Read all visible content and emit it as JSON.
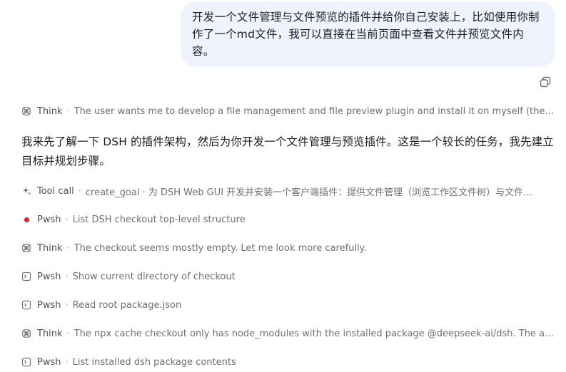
{
  "user_message": {
    "text": "开发一个文件管理与文件预览的插件并给你自己安装上，比如使用你制作了一个md文件，我可以直接在当前页面中查看文件并预览文件内容。"
  },
  "copy_icon": "copy-icon",
  "assistant_message": {
    "text": "我来先了解一下 DSH 的插件架构，然后为你开发一个文件管理与预览插件。这是一个较长的任务，我先建立目标并规划步骤。"
  },
  "steps": [
    {
      "kind": "Think",
      "icon": "brain-icon",
      "desc": "The user wants me to develop a file management and file preview plugin and install it on myself (the DSH h…"
    },
    {
      "kind": "Tool call",
      "icon": "sparkle-icon",
      "desc": "create_goal · 为 DSH Web GUI 开发并安装一个客户端插件：提供文件管理（浏览工作区文件树）与文件…"
    },
    {
      "kind": "Pwsh",
      "icon": "running-dot-icon",
      "desc": "List DSH checkout top-level structure"
    },
    {
      "kind": "Think",
      "icon": "brain-icon",
      "desc": "The checkout seems mostly empty. Let me look more carefully."
    },
    {
      "kind": "Pwsh",
      "icon": "terminal-icon",
      "desc": "Show current directory of checkout"
    },
    {
      "kind": "Pwsh",
      "icon": "terminal-icon",
      "desc": "Read root package.json"
    },
    {
      "kind": "Think",
      "icon": "brain-icon",
      "desc": "The npx cache checkout only has node_modules with the installed package @deepseek-ai/dsh. The actual s…"
    },
    {
      "kind": "Pwsh",
      "icon": "terminal-icon",
      "desc": "List installed dsh package contents"
    }
  ],
  "separator": "·"
}
